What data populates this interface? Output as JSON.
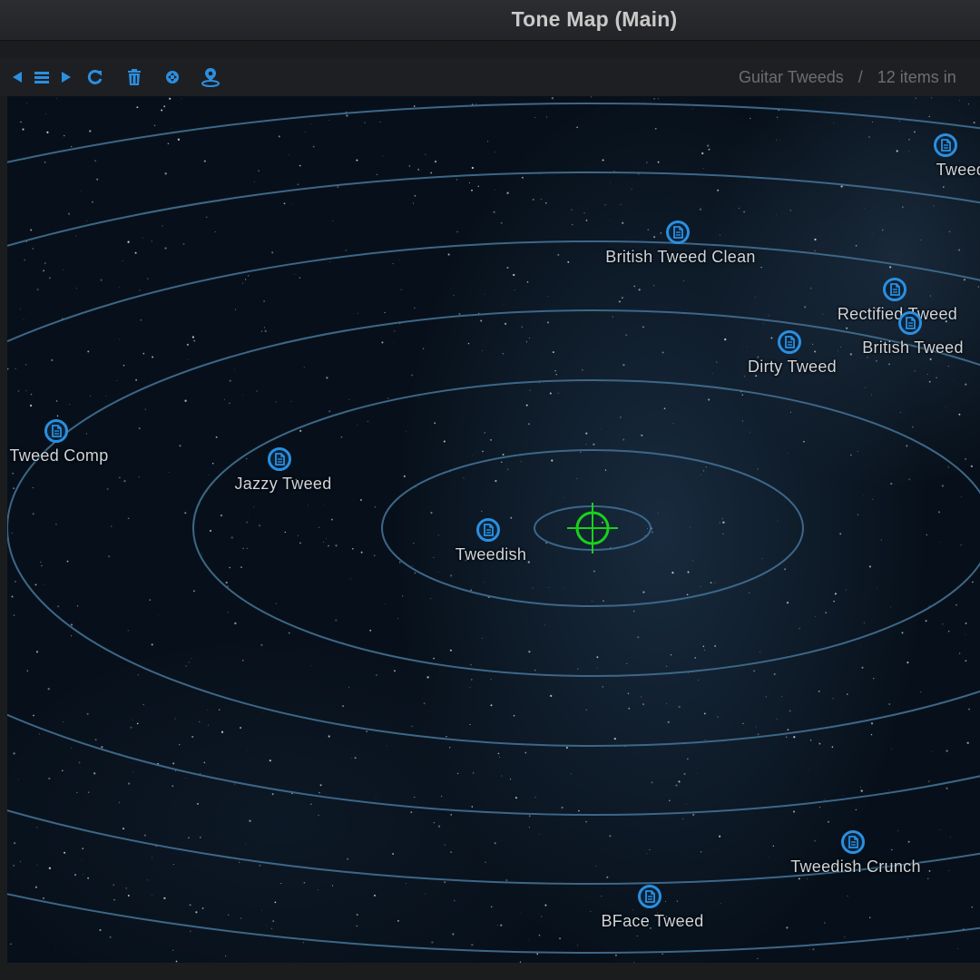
{
  "window": {
    "title": "Tone Map (Main)"
  },
  "toolbar": {
    "buttons": [
      {
        "name": "back-button",
        "icon": "back-arrow-icon"
      },
      {
        "name": "list-button",
        "icon": "list-icon"
      },
      {
        "name": "forward-button",
        "icon": "forward-arrow-icon"
      },
      {
        "name": "refresh-button",
        "icon": "refresh-icon"
      },
      {
        "name": "delete-button",
        "icon": "trash-icon"
      },
      {
        "name": "center-button",
        "icon": "move-center-icon"
      },
      {
        "name": "locate-button",
        "icon": "map-pin-icon"
      }
    ],
    "breadcrumb": {
      "collection": "Guitar Tweeds",
      "separator": "/",
      "count": "12 items in"
    }
  },
  "colors": {
    "accent": "#2b8fe0",
    "ring": "#3d6788",
    "crosshair": "#19d11b"
  },
  "map": {
    "presets": [
      {
        "label": "Tweed Hyb",
        "icon": "preset-file-icon"
      },
      {
        "label": "British Tweed Clean",
        "icon": "preset-file-icon"
      },
      {
        "label": "Rectified Tweed",
        "icon": "preset-file-icon"
      },
      {
        "label": "British Tweed",
        "icon": "preset-file-icon"
      },
      {
        "label": "Dirty Tweed",
        "icon": "preset-file-icon"
      },
      {
        "label": "Tweed Comp",
        "icon": "preset-file-icon"
      },
      {
        "label": "Jazzy Tweed",
        "icon": "preset-file-icon"
      },
      {
        "label": "Tweedish",
        "icon": "preset-file-icon"
      },
      {
        "label": "Tweedish Crunch",
        "icon": "preset-file-icon"
      },
      {
        "label": "BFace Tweed",
        "icon": "preset-file-icon"
      }
    ]
  }
}
